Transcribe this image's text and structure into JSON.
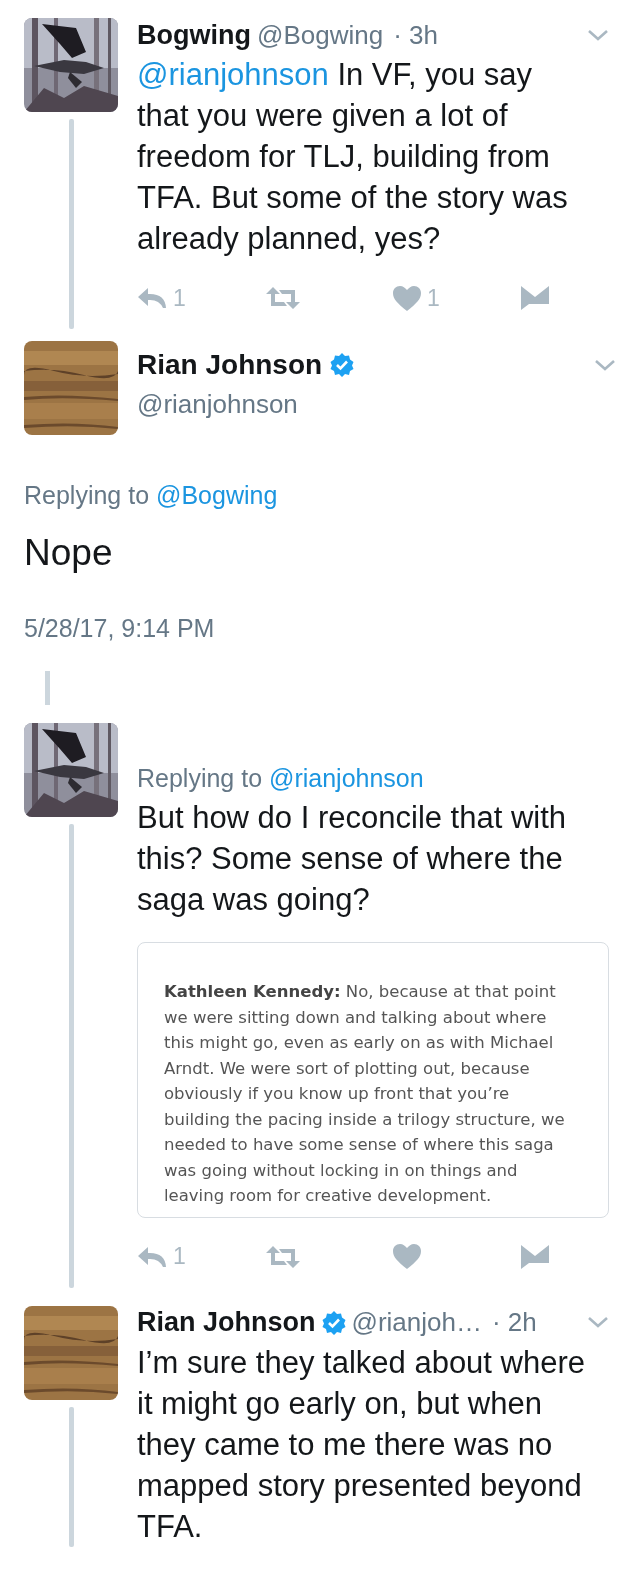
{
  "tweets": [
    {
      "kind": "thread",
      "name": "Bogwing",
      "verified": false,
      "handle": "@Bogwing",
      "time": "· 3h",
      "mention": "@rianjohnson",
      "text": "In VF, you say that you were given a lot of freedom for TLJ, building from TFA. But some of the story was already planned, yes?",
      "actions": [
        {
          "kind": "reply",
          "count": "1"
        },
        {
          "kind": "retweet"
        },
        {
          "kind": "like",
          "count": "1"
        },
        {
          "kind": "message"
        }
      ]
    },
    {
      "kind": "focal",
      "name": "Rian Johnson",
      "verified": true,
      "handle": "@rianjohnson",
      "replying_label": "Replying to",
      "replying_to": "@Bogwing",
      "text": "Nope",
      "date": "5/28/17, 9:14 PM"
    },
    {
      "kind": "thread",
      "replying_label": "Replying to",
      "replying_to": "@rianjohnson",
      "text": "But how do I reconcile that with this? Some sense of where the saga was going?",
      "attachment": "**Kathleen Kennedy:** No, because at that point we were sitting down and talking about where this might go, even as early on as with Michael Arndt. We were sort of plotting out, because obviously if you know up front that you’re building the pacing inside a trilogy structure, we needed to have some sense of where this saga was going without locking in on things and leaving room for creative development.",
      "actions": [
        {
          "kind": "reply",
          "count": "1"
        },
        {
          "kind": "retweet"
        },
        {
          "kind": "like"
        },
        {
          "kind": "message"
        }
      ]
    },
    {
      "kind": "thread",
      "name": "Rian Johnson",
      "verified": true,
      "handle": "@rianjoh…",
      "time": "· 2h",
      "text": "I’m sure they talked about where it might go early on, but when they came to me there was no mapped story presented beyond TFA."
    }
  ]
}
